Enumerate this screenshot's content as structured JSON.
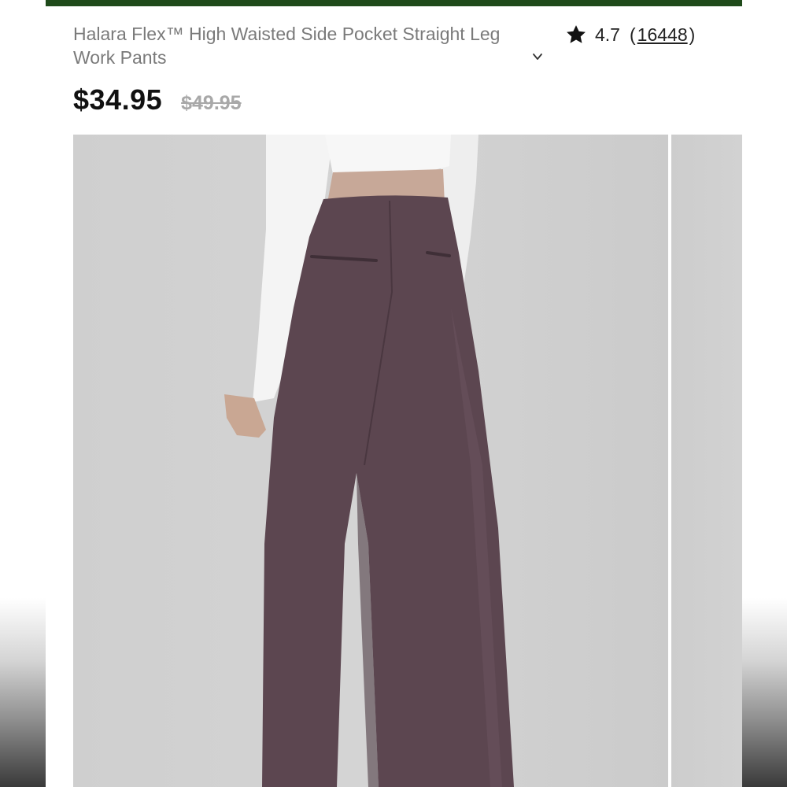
{
  "product": {
    "title": "Halara Flex™ High Waisted Side Pocket Straight Leg Work Pants",
    "rating": "4.7",
    "rating_open": "(",
    "review_count": "16448",
    "rating_close": ")",
    "price": "$34.95",
    "original_price": "$49.95"
  },
  "colors": {
    "top_bar": "#1f4a1a",
    "pants": "#5c4650",
    "top_garment": "#f4f4f4"
  },
  "icons": {
    "rating_star": "star-icon",
    "expand_title": "chevron-down-icon"
  }
}
